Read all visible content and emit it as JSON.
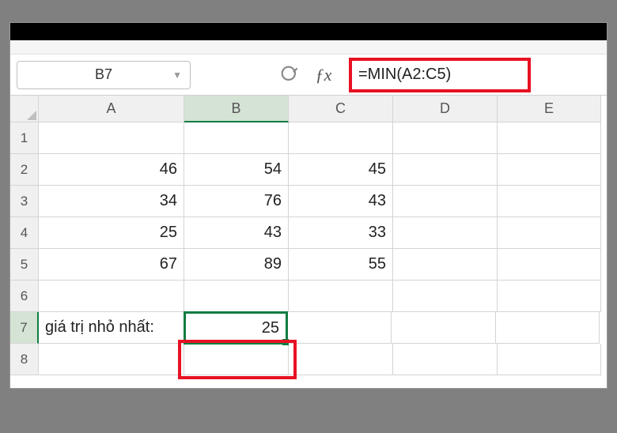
{
  "name_box": "B7",
  "formula": "=MIN(A2:C5)",
  "columns": [
    "A",
    "B",
    "C",
    "D",
    "E"
  ],
  "row_numbers": [
    "1",
    "2",
    "3",
    "4",
    "5",
    "6",
    "7",
    "8"
  ],
  "rows": {
    "1": {
      "A": "",
      "B": "",
      "C": "",
      "D": "",
      "E": ""
    },
    "2": {
      "A": "46",
      "B": "54",
      "C": "45",
      "D": "",
      "E": ""
    },
    "3": {
      "A": "34",
      "B": "76",
      "C": "43",
      "D": "",
      "E": ""
    },
    "4": {
      "A": "25",
      "B": "43",
      "C": "33",
      "D": "",
      "E": ""
    },
    "5": {
      "A": "67",
      "B": "89",
      "C": "55",
      "D": "",
      "E": ""
    },
    "6": {
      "A": "",
      "B": "",
      "C": "",
      "D": "",
      "E": ""
    },
    "7": {
      "A": "giá trị nhỏ nhất:",
      "B": "25",
      "C": "",
      "D": "",
      "E": ""
    },
    "8": {
      "A": "",
      "B": "",
      "C": "",
      "D": "",
      "E": ""
    }
  },
  "active_cell": {
    "row": "7",
    "col": "B"
  },
  "highlights": {
    "formula_bar_red_box": true,
    "b7_red_box": true
  },
  "fx_label": "ƒx"
}
